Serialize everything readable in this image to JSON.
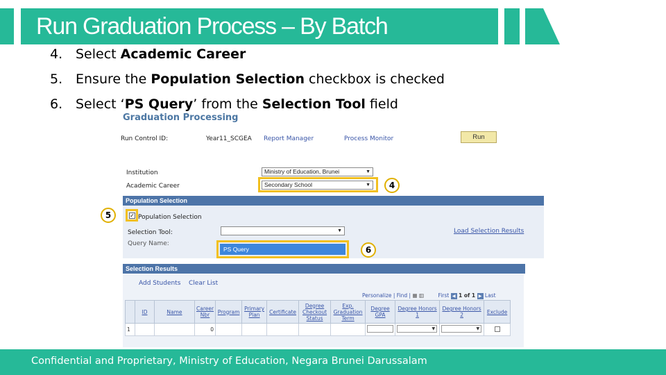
{
  "slide": {
    "title": "Run Graduation Process – By Batch",
    "footer": "Confidential and Proprietary, Ministry of Education, Negara Brunei Darussalam",
    "accent_color": "#26b998"
  },
  "steps": [
    {
      "num": "4.",
      "pre": "Select ",
      "bold": "Academic Career",
      "mid": "",
      "bold2": "",
      "post": ""
    },
    {
      "num": "5.",
      "pre": "Ensure the ",
      "bold": "Population Selection",
      "mid": " checkbox is checked",
      "bold2": "",
      "post": ""
    },
    {
      "num": "6.",
      "pre": "Select ‘",
      "bold": "PS Query",
      "mid": "’ from the ",
      "bold2": "Selection Tool",
      "post": " field"
    }
  ],
  "app": {
    "heading": "Graduation Processing",
    "run_control_label": "Run Control ID:",
    "run_control_value": "Year11_SCGEA",
    "report_manager": "Report Manager",
    "process_monitor": "Process Monitor",
    "run_button": "Run",
    "institution_label": "Institution",
    "institution_value": "Ministry of Education, Brunei",
    "career_label": "Academic Career",
    "career_value": "Secondary School",
    "population_header": "Population Selection",
    "population_checkbox_label": "Population Selection",
    "population_checked": true,
    "selection_tool_label": "Selection Tool:",
    "selection_tool_value": "",
    "query_name_label": "Query Name:",
    "query_option": "PS Query",
    "load_results": "Load Selection Results",
    "results_header": "Selection Results",
    "add_students": "Add Students",
    "clear_list": "Clear List",
    "grid_nav": {
      "personalize": "Personalize | Find |",
      "first": "First",
      "range": "1 of 1",
      "last": "Last"
    },
    "columns": [
      "ID",
      "Name",
      "Career Nbr",
      "Program",
      "Primary Plan",
      "Certificate",
      "Degree Checkout Status",
      "Exp. Graduation Term",
      "Degree GPA",
      "Degree Honors 1",
      "Degree Honors 2",
      "Exclude"
    ],
    "row": {
      "row_num": "1",
      "id": "",
      "name": "",
      "career_nbr": "0"
    }
  },
  "callouts": {
    "c4": "4",
    "c5": "5",
    "c6": "6",
    "highlight_color": "#f2c020"
  }
}
